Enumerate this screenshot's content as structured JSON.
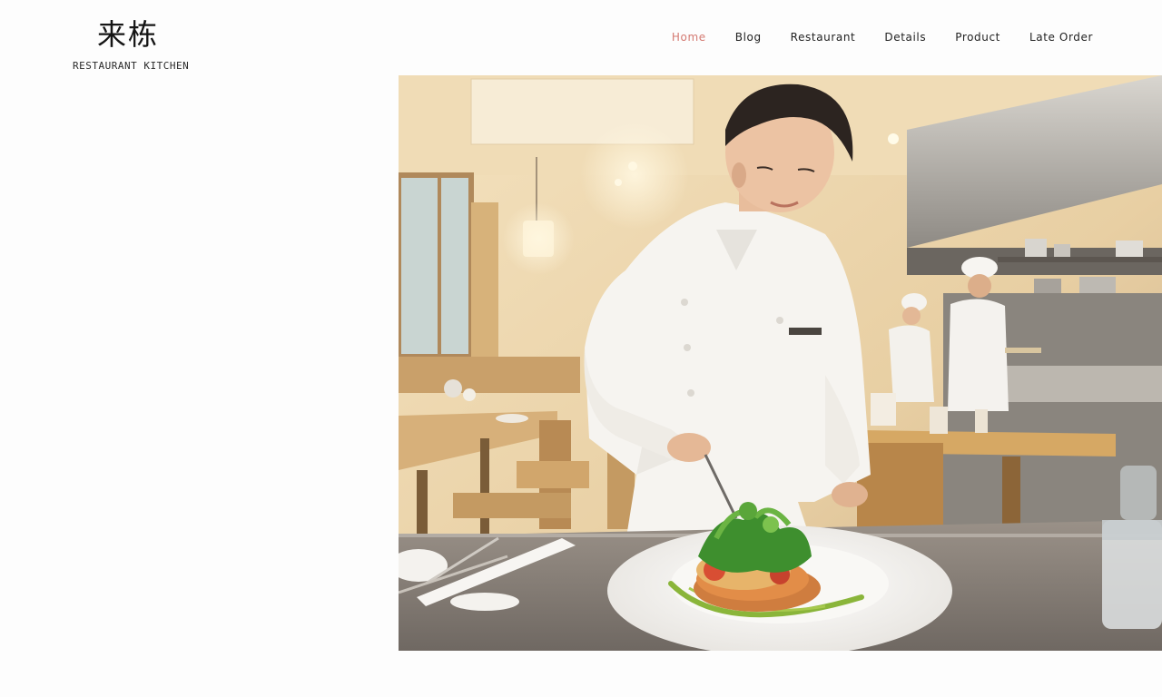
{
  "brand": {
    "logo_text": "来栋",
    "tagline": "RESTAURANT KITCHEN"
  },
  "nav": {
    "items": [
      {
        "label": "Home",
        "active": true
      },
      {
        "label": "Blog",
        "active": false
      },
      {
        "label": "Restaurant",
        "active": false
      },
      {
        "label": "Details",
        "active": false
      },
      {
        "label": "Product",
        "active": false
      },
      {
        "label": "Late Order",
        "active": false
      }
    ],
    "active_color": "#d47a72"
  },
  "hero": {
    "image_subject": "chef plating a salad dish in a restaurant kitchen"
  }
}
